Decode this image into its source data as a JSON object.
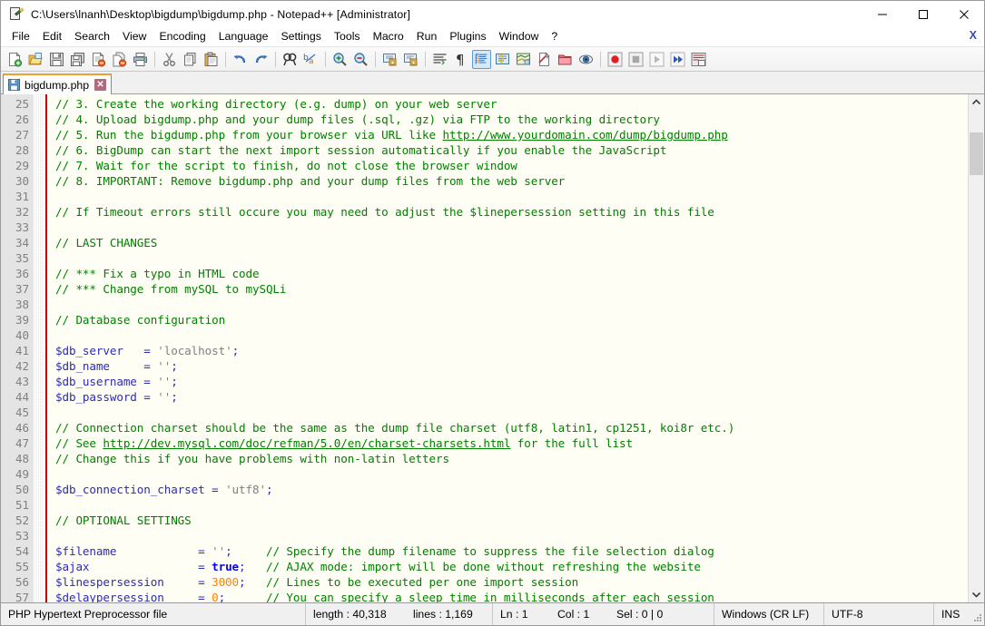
{
  "window": {
    "title": "C:\\Users\\lnanh\\Desktop\\bigdump\\bigdump.php - Notepad++ [Administrator]",
    "minimize_label": "–",
    "maximize_label": "□",
    "close_label": "✕",
    "close_document_label": "X"
  },
  "menu": {
    "items": [
      {
        "label": "File"
      },
      {
        "label": "Edit"
      },
      {
        "label": "Search"
      },
      {
        "label": "View"
      },
      {
        "label": "Encoding"
      },
      {
        "label": "Language"
      },
      {
        "label": "Settings"
      },
      {
        "label": "Tools"
      },
      {
        "label": "Macro"
      },
      {
        "label": "Run"
      },
      {
        "label": "Plugins"
      },
      {
        "label": "Window"
      },
      {
        "label": "?"
      }
    ]
  },
  "toolbar": {
    "items": [
      {
        "name": "new-file-icon",
        "tip": "New"
      },
      {
        "name": "open-file-icon",
        "tip": "Open"
      },
      {
        "name": "save-icon",
        "tip": "Save"
      },
      {
        "name": "save-all-icon",
        "tip": "Save All"
      },
      {
        "name": "close-file-icon",
        "tip": "Close"
      },
      {
        "name": "close-all-icon",
        "tip": "Close All"
      },
      {
        "name": "print-icon",
        "tip": "Print"
      },
      {
        "name": "separator-1",
        "tip": ""
      },
      {
        "name": "cut-icon",
        "tip": "Cut"
      },
      {
        "name": "copy-icon",
        "tip": "Copy"
      },
      {
        "name": "paste-icon",
        "tip": "Paste"
      },
      {
        "name": "separator-2",
        "tip": ""
      },
      {
        "name": "undo-icon",
        "tip": "Undo"
      },
      {
        "name": "redo-icon",
        "tip": "Redo"
      },
      {
        "name": "separator-3",
        "tip": ""
      },
      {
        "name": "find-icon",
        "tip": "Find"
      },
      {
        "name": "replace-icon",
        "tip": "Replace"
      },
      {
        "name": "separator-4",
        "tip": ""
      },
      {
        "name": "zoom-in-icon",
        "tip": "Zoom In"
      },
      {
        "name": "zoom-out-icon",
        "tip": "Zoom Out"
      },
      {
        "name": "separator-5",
        "tip": ""
      },
      {
        "name": "sync-vertical-scroll-icon",
        "tip": "Synchronize Vertical Scrolling"
      },
      {
        "name": "sync-horizontal-scroll-icon",
        "tip": "Synchronize Horizontal Scrolling"
      },
      {
        "name": "separator-6",
        "tip": ""
      },
      {
        "name": "word-wrap-icon",
        "tip": "Word wrap"
      },
      {
        "name": "show-all-characters-icon",
        "tip": "Show All Characters"
      },
      {
        "name": "indent-guide-icon",
        "tip": "Show Indent Guide"
      },
      {
        "name": "user-defined-language-icon",
        "tip": "User-Defined Dialogue"
      },
      {
        "name": "document-map-icon",
        "tip": "Document Map"
      },
      {
        "name": "function-list-icon",
        "tip": "Function List"
      },
      {
        "name": "folder-as-workspace-icon",
        "tip": "Folder as Workspace"
      },
      {
        "name": "monitoring-icon",
        "tip": "Monitoring"
      },
      {
        "name": "separator-7",
        "tip": ""
      },
      {
        "name": "record-macro-icon",
        "tip": "Start Recording"
      },
      {
        "name": "stop-macro-icon",
        "tip": "Stop Recording"
      },
      {
        "name": "play-macro-icon",
        "tip": "Playback"
      },
      {
        "name": "run-macro-multiple-icon",
        "tip": "Run a Macro Multiple Times"
      },
      {
        "name": "save-macro-icon",
        "tip": "Save Currently Recorded Macro"
      }
    ]
  },
  "tabs": [
    {
      "label": "bigdump.php",
      "close": "✕",
      "active": true
    }
  ],
  "editor": {
    "first_line": 25,
    "lines": [
      {
        "n": 25,
        "tokens": [
          {
            "t": "// 3. Create the working directory (e.g. dump) on your web server",
            "c": "tk-com"
          }
        ]
      },
      {
        "n": 26,
        "tokens": [
          {
            "t": "// 4. Upload bigdump.php and your dump files (.sql, .gz) via FTP to the working directory",
            "c": "tk-com"
          }
        ]
      },
      {
        "n": 27,
        "tokens": [
          {
            "t": "// 5. Run the bigdump.php from your browser via URL like ",
            "c": "tk-com"
          },
          {
            "t": "http://www.yourdomain.com/dump/bigdump.php",
            "c": "tk-url"
          }
        ]
      },
      {
        "n": 28,
        "tokens": [
          {
            "t": "// 6. BigDump can start the next import session automatically if you enable the JavaScript",
            "c": "tk-com"
          }
        ]
      },
      {
        "n": 29,
        "tokens": [
          {
            "t": "// 7. Wait for the script to finish, do not close the browser window",
            "c": "tk-com"
          }
        ]
      },
      {
        "n": 30,
        "tokens": [
          {
            "t": "// 8. IMPORTANT: Remove bigdump.php and your dump files from the web server",
            "c": "tk-com"
          }
        ]
      },
      {
        "n": 31,
        "tokens": []
      },
      {
        "n": 32,
        "tokens": [
          {
            "t": "// If Timeout errors still occure you may need to adjust the $linepersession setting in this file",
            "c": "tk-com"
          }
        ]
      },
      {
        "n": 33,
        "tokens": []
      },
      {
        "n": 34,
        "tokens": [
          {
            "t": "// LAST CHANGES",
            "c": "tk-com"
          }
        ]
      },
      {
        "n": 35,
        "tokens": []
      },
      {
        "n": 36,
        "tokens": [
          {
            "t": "// *** Fix a typo in HTML code",
            "c": "tk-com"
          }
        ]
      },
      {
        "n": 37,
        "tokens": [
          {
            "t": "// *** Change from mySQL to mySQLi",
            "c": "tk-com"
          }
        ]
      },
      {
        "n": 38,
        "tokens": []
      },
      {
        "n": 39,
        "tokens": [
          {
            "t": "// Database configuration",
            "c": "tk-com"
          }
        ]
      },
      {
        "n": 40,
        "tokens": []
      },
      {
        "n": 41,
        "tokens": [
          {
            "t": "$db_server",
            "c": "tk-var"
          },
          {
            "t": "   = ",
            "c": "tk-op"
          },
          {
            "t": "'localhost'",
            "c": "tk-str"
          },
          {
            "t": ";",
            "c": "tk-pun"
          }
        ]
      },
      {
        "n": 42,
        "tokens": [
          {
            "t": "$db_name",
            "c": "tk-var"
          },
          {
            "t": "     = ",
            "c": "tk-op"
          },
          {
            "t": "''",
            "c": "tk-str"
          },
          {
            "t": ";",
            "c": "tk-pun"
          }
        ]
      },
      {
        "n": 43,
        "tokens": [
          {
            "t": "$db_username",
            "c": "tk-var"
          },
          {
            "t": " = ",
            "c": "tk-op"
          },
          {
            "t": "''",
            "c": "tk-str"
          },
          {
            "t": ";",
            "c": "tk-pun"
          }
        ]
      },
      {
        "n": 44,
        "tokens": [
          {
            "t": "$db_password",
            "c": "tk-var"
          },
          {
            "t": " = ",
            "c": "tk-op"
          },
          {
            "t": "''",
            "c": "tk-str"
          },
          {
            "t": ";",
            "c": "tk-pun"
          }
        ]
      },
      {
        "n": 45,
        "tokens": []
      },
      {
        "n": 46,
        "tokens": [
          {
            "t": "// Connection charset should be the same as the dump file charset (utf8, latin1, cp1251, koi8r etc.)",
            "c": "tk-com"
          }
        ]
      },
      {
        "n": 47,
        "tokens": [
          {
            "t": "// See ",
            "c": "tk-com"
          },
          {
            "t": "http://dev.mysql.com/doc/refman/5.0/en/charset-charsets.html",
            "c": "tk-url"
          },
          {
            "t": " for the full list",
            "c": "tk-com"
          }
        ]
      },
      {
        "n": 48,
        "tokens": [
          {
            "t": "// Change this if you have problems with non-latin letters",
            "c": "tk-com"
          }
        ]
      },
      {
        "n": 49,
        "tokens": []
      },
      {
        "n": 50,
        "tokens": [
          {
            "t": "$db_connection_charset",
            "c": "tk-var"
          },
          {
            "t": " = ",
            "c": "tk-op"
          },
          {
            "t": "'utf8'",
            "c": "tk-str"
          },
          {
            "t": ";",
            "c": "tk-pun"
          }
        ]
      },
      {
        "n": 51,
        "tokens": []
      },
      {
        "n": 52,
        "tokens": [
          {
            "t": "// OPTIONAL SETTINGS",
            "c": "tk-com"
          }
        ]
      },
      {
        "n": 53,
        "tokens": []
      },
      {
        "n": 54,
        "tokens": [
          {
            "t": "$filename",
            "c": "tk-var"
          },
          {
            "t": "            = ",
            "c": "tk-op"
          },
          {
            "t": "''",
            "c": "tk-str"
          },
          {
            "t": ";",
            "c": "tk-pun"
          },
          {
            "t": "     ",
            "c": "tk-op"
          },
          {
            "t": "// Specify the dump filename to suppress the file selection dialog",
            "c": "tk-com"
          }
        ]
      },
      {
        "n": 55,
        "tokens": [
          {
            "t": "$ajax",
            "c": "tk-var"
          },
          {
            "t": "                = ",
            "c": "tk-op"
          },
          {
            "t": "true",
            "c": "tk-kw"
          },
          {
            "t": ";",
            "c": "tk-pun"
          },
          {
            "t": "   ",
            "c": "tk-op"
          },
          {
            "t": "// AJAX mode: import will be done without refreshing the website",
            "c": "tk-com"
          }
        ]
      },
      {
        "n": 56,
        "tokens": [
          {
            "t": "$linespersession",
            "c": "tk-var"
          },
          {
            "t": "     = ",
            "c": "tk-op"
          },
          {
            "t": "3000",
            "c": "tk-num"
          },
          {
            "t": ";",
            "c": "tk-pun"
          },
          {
            "t": "   ",
            "c": "tk-op"
          },
          {
            "t": "// Lines to be executed per one import session",
            "c": "tk-com"
          }
        ]
      },
      {
        "n": 57,
        "tokens": [
          {
            "t": "$delaypersession",
            "c": "tk-var"
          },
          {
            "t": "     = ",
            "c": "tk-op"
          },
          {
            "t": "0",
            "c": "tk-num"
          },
          {
            "t": ";",
            "c": "tk-pun"
          },
          {
            "t": "      ",
            "c": "tk-op"
          },
          {
            "t": "// You can specify a sleep time in milliseconds after each session",
            "c": "tk-com"
          }
        ]
      }
    ]
  },
  "statusbar": {
    "file_type": "PHP Hypertext Preprocessor file",
    "length_label": "length : 40,318",
    "lines_label": "lines : 1,169",
    "ln_label": "Ln : 1",
    "col_label": "Col : 1",
    "sel_label": "Sel : 0 | 0",
    "eol_label": "Windows (CR LF)",
    "encoding_label": "UTF-8",
    "insert_mode_label": "INS"
  },
  "colors": {
    "comment": "#008000",
    "variable": "#2b2bb5",
    "string": "#808080",
    "number": "#ff8000",
    "keyword": "#0000ff",
    "editor_bg": "#fffef5",
    "gutter_bg": "#e4e4e4",
    "fold_margin": "#cc0000",
    "tab_accent": "#f0a030"
  }
}
